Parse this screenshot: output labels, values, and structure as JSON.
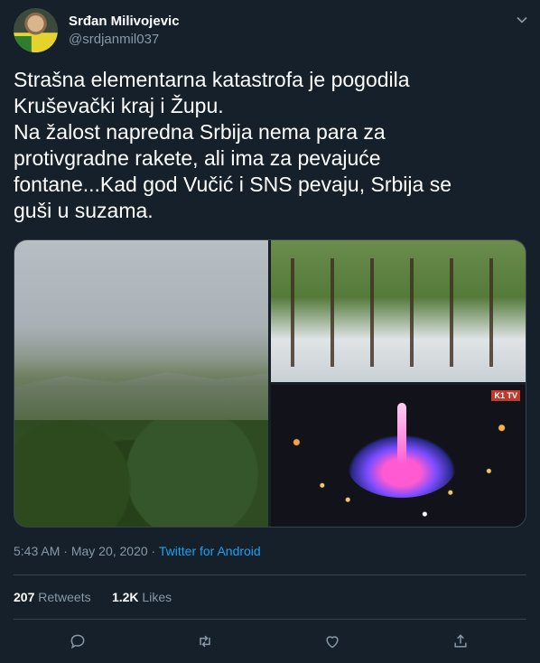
{
  "author": {
    "name": "Srđan Milivojevic",
    "handle": "@srdjanmil037",
    "avatar_icon": "profile-photo-icon"
  },
  "tweet": {
    "text": "Strašna elementarna katastrofa je pogodila\nKruševački kraj i Župu.\nNa žalost napredna Srbija nema para za\nprotivgradne rakete, ali ima za pevajuće\nfontane...Kad god Vučić i SNS pevaju, Srbija se\nguši u suzama."
  },
  "media": {
    "tv_logo": "K1 TV"
  },
  "meta": {
    "time": "5:43 AM",
    "sep": " · ",
    "date": "May 20, 2020",
    "sep2": " · ",
    "source": "Twitter for Android"
  },
  "stats": {
    "retweets_count": "207",
    "retweets_label": "Retweets",
    "likes_count": "1.2K",
    "likes_label": "Likes"
  },
  "actions": {
    "icons": [
      "reply-icon",
      "retweet-icon",
      "like-icon",
      "share-icon"
    ]
  },
  "colors": {
    "background": "#15202b",
    "secondary_text": "#8899a6",
    "link": "#1da1f2",
    "divider": "#38444d"
  }
}
